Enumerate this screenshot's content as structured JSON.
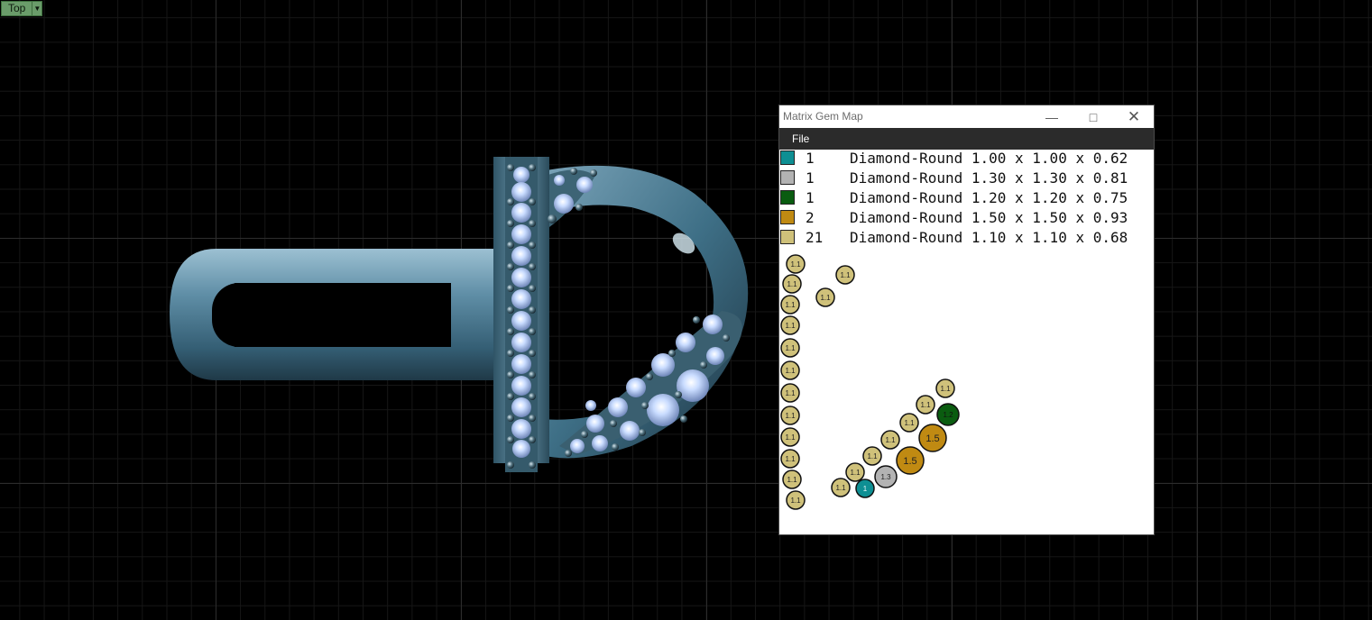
{
  "viewport": {
    "name": "Top",
    "background": "#000000"
  },
  "window": {
    "title": "Matrix Gem Map",
    "menu": [
      "File"
    ],
    "legend": [
      {
        "count": "1",
        "description": "Diamond-Round 1.00 x 1.00 x 0.62",
        "color": "#0e8f93"
      },
      {
        "count": "1",
        "description": "Diamond-Round 1.30 x 1.30 x 0.81",
        "color": "#b3b3b3"
      },
      {
        "count": "1",
        "description": "Diamond-Round 1.20 x 1.20 x 0.75",
        "color": "#0a5c10"
      },
      {
        "count": "2",
        "description": "Diamond-Round 1.50 x 1.50 x 0.93",
        "color": "#c08a12"
      },
      {
        "count": "21",
        "description": "Diamond-Round 1.10 x 1.10 x 0.68",
        "color": "#cfc17a"
      }
    ],
    "gem_labels": {
      "size_1_1": "1.1",
      "size_1_3": "1.3",
      "size_1_0": "1",
      "size_1_5": "1.5",
      "size_1_2": "1.2"
    }
  },
  "icons": [
    "minimize-icon",
    "maximize-icon",
    "close-icon",
    "dropdown-arrow-icon"
  ]
}
